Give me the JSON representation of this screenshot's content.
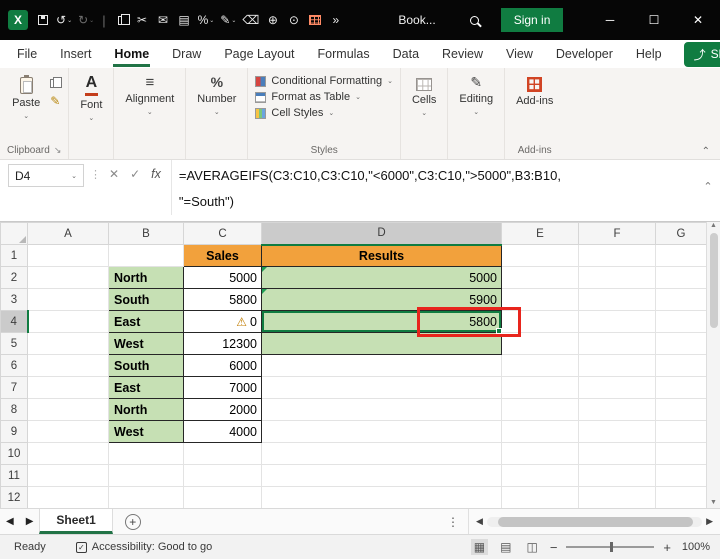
{
  "titlebar": {
    "doc_title": "Book...",
    "sign_in_label": "Sign in"
  },
  "menubar": {
    "tabs": [
      "File",
      "Insert",
      "Home",
      "Draw",
      "Page Layout",
      "Formulas",
      "Data",
      "Review",
      "View",
      "Developer",
      "Help"
    ],
    "active_tab": "Home",
    "share_label": "Share"
  },
  "ribbon": {
    "paste_label": "Paste",
    "clipboard_group_label": "Clipboard",
    "font_label": "Font",
    "alignment_label": "Alignment",
    "number_label": "Number",
    "conditional_formatting_label": "Conditional Formatting",
    "format_as_table_label": "Format as Table",
    "cell_styles_label": "Cell Styles",
    "styles_group_label": "Styles",
    "cells_label": "Cells",
    "editing_label": "Editing",
    "addins_label": "Add-ins",
    "addins_group_label": "Add-ins"
  },
  "formula_bar": {
    "name_box": "D4",
    "fx_label": "fx",
    "formula_line1": "=AVERAGEIFS(C3:C10,C3:C10,\"<6000\",C3:C10,\">5000\",B3:B10,",
    "formula_line2": "\"=South\")"
  },
  "grid": {
    "col_headers": [
      "A",
      "B",
      "C",
      "D",
      "E",
      "F",
      "G"
    ],
    "row_headers": [
      "1",
      "2",
      "3",
      "4",
      "5",
      "6",
      "7",
      "8",
      "9",
      "10",
      "11",
      "12"
    ],
    "selected_col": "D",
    "selected_row": "4",
    "cells": {
      "C1": {
        "text": "Sales",
        "cls": "hdr"
      },
      "D1": {
        "text": "Results",
        "cls": "hdr"
      },
      "B2": {
        "text": "North",
        "cls": "region"
      },
      "C2": {
        "text": "5000",
        "cls": "num"
      },
      "D2": {
        "text": "5000",
        "cls": "result corner"
      },
      "B3": {
        "text": "South",
        "cls": "region"
      },
      "C3": {
        "text": "5800",
        "cls": "num"
      },
      "D3": {
        "text": "5900",
        "cls": "result corner"
      },
      "B4": {
        "text": "East",
        "cls": "region"
      },
      "C4": {
        "text": "0",
        "cls": "num warn"
      },
      "D4": {
        "text": "5800",
        "cls": "result selected"
      },
      "B5": {
        "text": "West",
        "cls": "region"
      },
      "C5": {
        "text": "12300",
        "cls": "num"
      },
      "D5": {
        "text": "",
        "cls": "result"
      },
      "B6": {
        "text": "South",
        "cls": "region"
      },
      "C6": {
        "text": "6000",
        "cls": "num"
      },
      "B7": {
        "text": "East",
        "cls": "region"
      },
      "C7": {
        "text": "7000",
        "cls": "num"
      },
      "B8": {
        "text": "North",
        "cls": "region"
      },
      "C8": {
        "text": "2000",
        "cls": "num"
      },
      "B9": {
        "text": "West",
        "cls": "region"
      },
      "C9": {
        "text": "4000",
        "cls": "num"
      }
    }
  },
  "sheetbar": {
    "tab_label": "Sheet1"
  },
  "statusbar": {
    "mode": "Ready",
    "accessibility": "Accessibility: Good to go",
    "zoom": "100%"
  }
}
